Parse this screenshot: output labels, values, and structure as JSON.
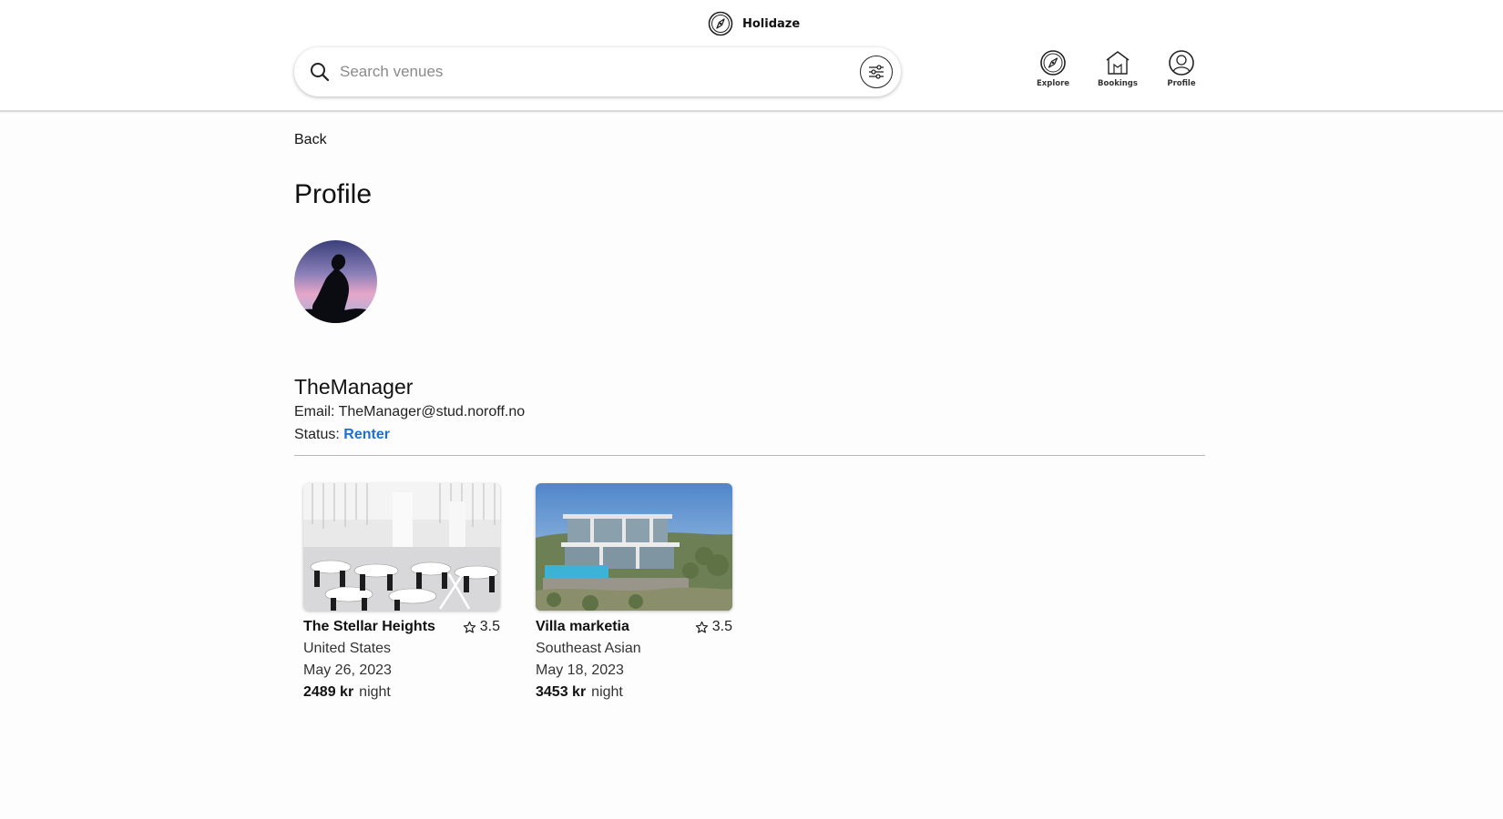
{
  "brand": {
    "name": "Holidaze",
    "logo_icon": "compass-logo-icon"
  },
  "search": {
    "placeholder": "Search venues",
    "value": ""
  },
  "nav": [
    {
      "label": "Explore",
      "icon": "compass-icon"
    },
    {
      "label": "Bookings",
      "icon": "house-icon"
    },
    {
      "label": "Profile",
      "icon": "user-icon"
    }
  ],
  "back_label": "Back",
  "page_title": "Profile",
  "profile": {
    "name": "TheManager",
    "email_label": "Email:",
    "email": "TheManager@stud.noroff.no",
    "status_label": "Status:",
    "status": "Renter",
    "status_color": "#1e6fd1"
  },
  "venues": [
    {
      "name": "The Stellar Heights",
      "rating": "3.5",
      "location": "United States",
      "date": "May 26, 2023",
      "price": "2489 kr",
      "unit": "night"
    },
    {
      "name": "Villa marketia",
      "rating": "3.5",
      "location": "Southeast Asian",
      "date": "May 18, 2023",
      "price": "3453 kr",
      "unit": "night"
    }
  ]
}
